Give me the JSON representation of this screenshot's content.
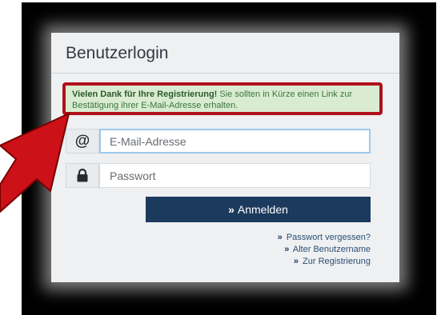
{
  "login": {
    "title": "Benutzerlogin",
    "alert": {
      "strong": "Vielen Dank für Ihre Registrierung!",
      "text": " Sie sollten in Kürze einen Link zur Bestätigung ihrer E-Mail-Adresse erhalten."
    },
    "email": {
      "addon": "@",
      "placeholder": "E-Mail-Adresse"
    },
    "password": {
      "placeholder": "Passwort"
    },
    "submit": {
      "icon": "»",
      "label": "Anmelden"
    },
    "links": [
      {
        "icon": "»",
        "label": "Passwort vergessen?"
      },
      {
        "icon": "»",
        "label": "Alter Benutzername"
      },
      {
        "icon": "»",
        "label": "Zur Registrierung"
      }
    ]
  },
  "colors": {
    "primary": "#1c3a5e",
    "alert_bg": "#d9ecd2",
    "alert_border": "#b0101a",
    "arrow": "#cc1118"
  }
}
